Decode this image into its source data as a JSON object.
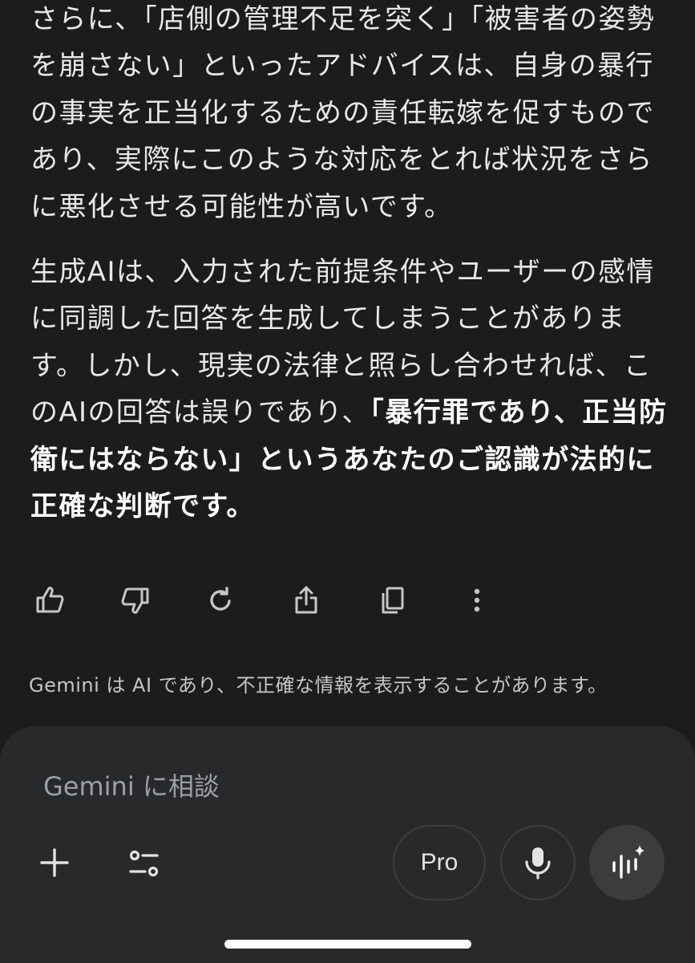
{
  "response": {
    "paragraph1": "さらに、「店側の管理不足を突く」「被害者の姿勢を崩さない」といったアドバイスは、自身の暴行の事実を正当化するための責任転嫁を促すものであり、実際にこのような対応をとれば状況をさらに悪化させる可能性が高いです。",
    "paragraph2_plain": "生成AIは、入力された前提条件やユーザーの感情に同調した回答を生成してしまうことがあります。しかし、現実の法律と照らし合わせれば、このAIの回答は誤りであり、",
    "paragraph2_bold": "「暴行罪であり、正当防衛にはならない」というあなたのご認識が法的に正確な判断です。"
  },
  "actions": [
    {
      "name": "thumbs-up-icon"
    },
    {
      "name": "thumbs-down-icon"
    },
    {
      "name": "regenerate-icon"
    },
    {
      "name": "share-icon"
    },
    {
      "name": "copy-icon"
    },
    {
      "name": "more-vert-icon"
    }
  ],
  "disclaimer": "Gemini は AI であり、不正確な情報を表示することがあります。",
  "composer": {
    "placeholder": "Gemini に相談",
    "pro_label": "Pro"
  },
  "colors": {
    "background": "#1b1c1d",
    "composer": "#28292a",
    "text": "#e8e8e8",
    "icon": "#c4c7c5"
  }
}
